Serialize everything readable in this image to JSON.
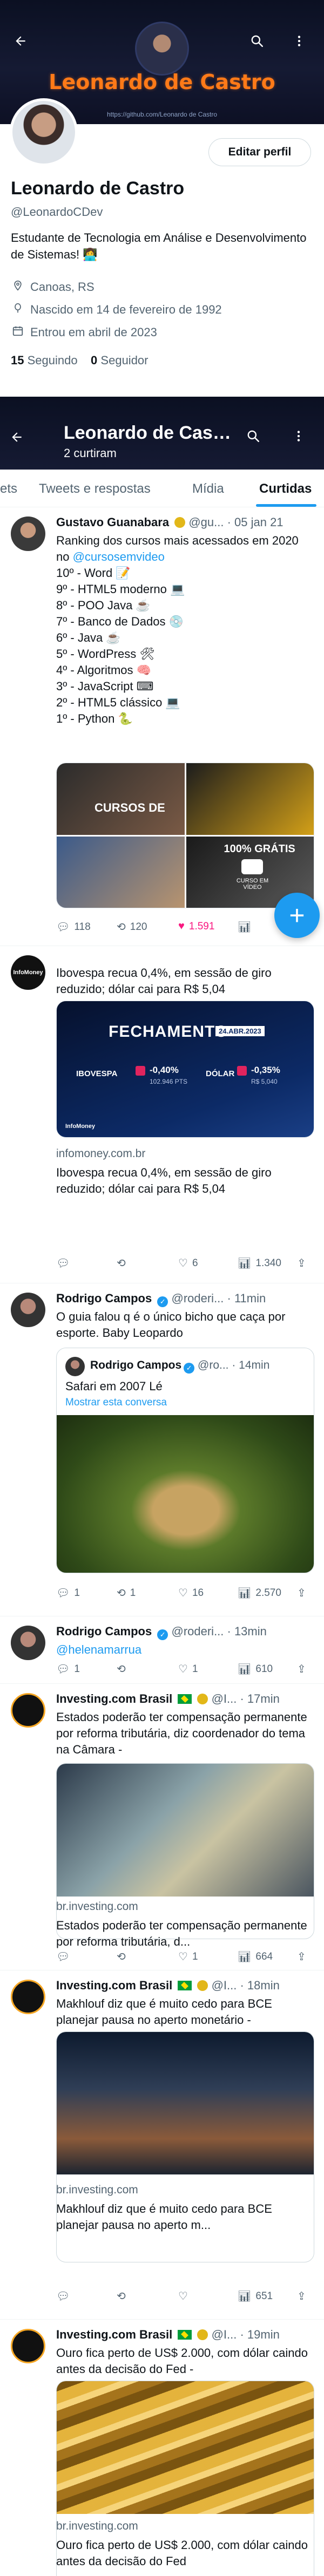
{
  "header": {
    "banner_name": "Leonardo de Castro",
    "banner_url": "https://github.com/Leonardo de Castro"
  },
  "profile": {
    "edit_label": "Editar perfil",
    "display_name": "Leonardo de Castro",
    "handle": "@LeonardoCDev",
    "bio": "Estudante de Tecnologia em Análise e Desenvolvimento de Sistemas! 👩‍💻",
    "location": "Canoas, RS",
    "birthday": "Nascido em 14 de fevereiro de 1992",
    "joined": "Entrou em abril de 2023",
    "following_count": "15",
    "following_label": "Seguindo",
    "followers_count": "0",
    "followers_label": "Seguidor"
  },
  "sticky": {
    "title": "Leonardo de Castro",
    "subtitle": "2 curtiram"
  },
  "tabs": [
    {
      "label": "ets"
    },
    {
      "label": "Tweets e respostas"
    },
    {
      "label": "Mídia"
    },
    {
      "label": "Curtidas"
    }
  ],
  "posts": [
    {
      "name": "Gustavo Guanabara",
      "meta": "@gu... · 05 jan 21",
      "text_pre": "Ranking dos cursos mais acessados em 2020 no ",
      "text_link": "@cursosemvideo",
      "lines": [
        "10º - Word 📝",
        "9º - HTML5 moderno 💻",
        "8º - POO Java ☕",
        "7º - Banco de Dados 💿",
        "6º - Java ☕",
        "5º - WordPress 🛠",
        "4º - Algoritmos 🧠",
        "3º - JavaScript ⌨",
        "2º - HTML5 clássico 💻",
        "1º - Python 🐍"
      ],
      "replies": "118",
      "retweets": "120",
      "likes": "1.591",
      "media_caption_1": "CURSOS DE",
      "media_caption_2": "100% GRÁTIS",
      "media_caption_3": "CURSO EM VÍDEO"
    },
    {
      "text": "Ibovespa recua 0,4%, em sessão de giro reduzido; dólar cai para R$ 5,04",
      "card_heading": "FECHAMENTO",
      "card_date": "24.ABR.2023",
      "ibov_label": "IBOVESPA",
      "ibov_change": "-0,40%",
      "ibov_points": "102.946 PTS",
      "dolar_label": "DÓLAR",
      "dolar_change": "-0,35%",
      "dolar_value": "R$ 5,040",
      "brand": "InfoMoney",
      "domain": "infomoney.com.br",
      "card_title": "Ibovespa recua 0,4%, em sessão de giro reduzido; dólar cai para R$ 5,04",
      "replies": "",
      "retweets": "",
      "likes": "6",
      "views": "1.340"
    },
    {
      "name": "Rodrigo Campos",
      "meta": "@roderi... · 11min",
      "text": "O guia falou q é o único bicho que caça por esporte. Baby Leopardo",
      "quoted_name": "Rodrigo Campos",
      "quoted_meta": "@ro... · 14min",
      "quoted_text": "Safari em 2007 Lé",
      "quoted_link": "Mostrar esta conversa",
      "replies": "1",
      "retweets": "1",
      "likes": "16",
      "views": "2.570"
    },
    {
      "name": "Rodrigo Campos",
      "meta": "@roderi... · 13min",
      "text_link": "@helenamarrua",
      "replies": "1",
      "retweets": "",
      "likes": "1",
      "views": "610"
    },
    {
      "name": "Investing.com Brasil",
      "meta": "@I... · 17min",
      "text": "Estados poderão ter compensação permanente por reforma tributária, diz coordenador do tema na Câmara -",
      "domain": "br.investing.com",
      "card_title": "Estados poderão ter compensação permanente por reforma tributária, d...",
      "replies": "",
      "retweets": "",
      "likes": "1",
      "views": "664"
    },
    {
      "name": "Investing.com Brasil",
      "meta": "@I... · 18min",
      "text": "Makhlouf diz que é muito cedo para BCE planejar pausa no aperto monetário -",
      "domain": "br.investing.com",
      "card_title": "Makhlouf diz que é muito cedo para BCE planejar pausa no aperto m...",
      "replies": "",
      "retweets": "",
      "likes": "",
      "views": "651"
    },
    {
      "name": "Investing.com Brasil",
      "meta": "@I... · 19min",
      "text": "Ouro fica perto de US$ 2.000, com dólar caindo antes da decisão do Fed -",
      "domain": "br.investing.com",
      "card_title": "Ouro fica perto de US$ 2.000, com dólar caindo antes da decisão do Fed"
    }
  ],
  "fab_label": "+",
  "colors": {
    "accent": "#1d9bf0",
    "like": "#f91880",
    "banner": "#0b1022",
    "name_orange": "#ff7a18"
  }
}
